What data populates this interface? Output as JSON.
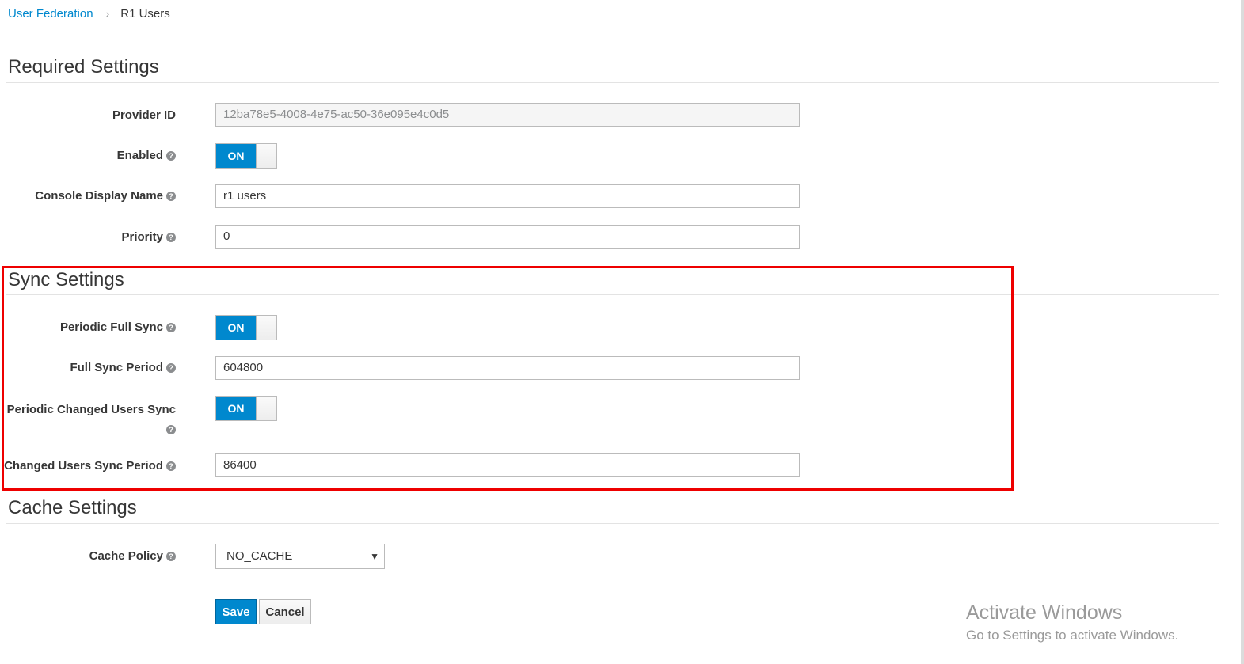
{
  "breadcrumb": {
    "parent": "User Federation",
    "separator": "›",
    "current": "R1 Users"
  },
  "required": {
    "title": "Required Settings",
    "provider_id_label": "Provider ID",
    "provider_id_value": "12ba78e5-4008-4e75-ac50-36e095e4c0d5",
    "enabled_label": "Enabled",
    "enabled_state": "ON",
    "display_name_label": "Console Display Name",
    "display_name_value": "r1 users",
    "priority_label": "Priority",
    "priority_value": "0"
  },
  "sync": {
    "title": "Sync Settings",
    "periodic_full_label": "Periodic Full Sync",
    "periodic_full_state": "ON",
    "full_period_label": "Full Sync Period",
    "full_period_value": "604800",
    "periodic_changed_label": "Periodic Changed Users Sync",
    "periodic_changed_state": "ON",
    "changed_period_label": "Changed Users Sync Period",
    "changed_period_value": "86400"
  },
  "cache": {
    "title": "Cache Settings",
    "policy_label": "Cache Policy",
    "policy_value": "NO_CACHE"
  },
  "actions": {
    "save": "Save",
    "cancel": "Cancel"
  },
  "watermark": {
    "line1": "Activate Windows",
    "line2": "Go to Settings to activate Windows."
  },
  "colors": {
    "accent": "#0088ce",
    "highlight": "#ee0000"
  },
  "icons": {
    "help": "question-circle-icon",
    "chevron": "chevron-down-icon",
    "separator": "chevron-right-icon"
  }
}
